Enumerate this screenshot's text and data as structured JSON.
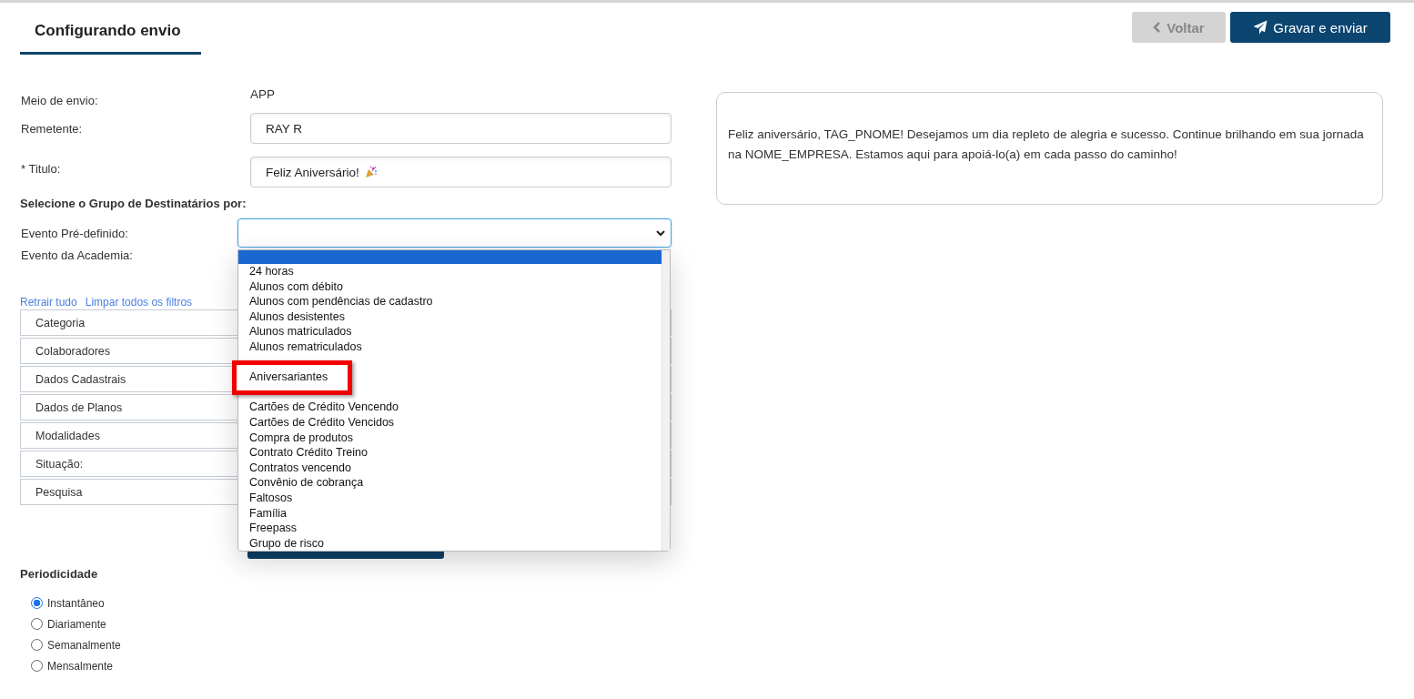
{
  "header": {
    "title": "Configurando envio"
  },
  "actions": [
    {
      "label": "Voltar",
      "kind": "back"
    },
    {
      "label": "Gravar e enviar",
      "kind": "send"
    }
  ],
  "form": {
    "sender_type": {
      "label": "Meio de envio:",
      "value": "APP"
    },
    "sender": {
      "label": "Remetente:",
      "value": "RAY R"
    },
    "title": {
      "label": "* Titulo:",
      "value": "Feliz Aniversário!"
    },
    "group_heading": "Selecione o Grupo de Destinatários por:",
    "predefined_event": {
      "label": "Evento Pré-definido:",
      "expanded": true,
      "options": [
        {
          "selected": true,
          "callout": false
        },
        {
          "label": "24 horas",
          "selected": false,
          "callout": false
        },
        {
          "label": "Alunos com débito",
          "selected": false,
          "callout": false
        },
        {
          "label": "Alunos com pendências de cadastro",
          "selected": false,
          "callout": false
        },
        {
          "label": "Alunos desistentes",
          "selected": false,
          "callout": false
        },
        {
          "label": "Alunos matriculados",
          "selected": false,
          "callout": false
        },
        {
          "label": "Alunos rematriculados",
          "selected": false,
          "callout": false
        },
        {
          "label": "Aniversariantes",
          "selected": false,
          "callout": true
        },
        {
          "label": "Cartões de Crédito Vencendo",
          "selected": false,
          "callout": false
        },
        {
          "label": "Cartões de Crédito Vencidos",
          "selected": false,
          "callout": false
        },
        {
          "label": "Compra de produtos",
          "selected": false,
          "callout": false
        },
        {
          "label": "Contrato Crédito Treino",
          "selected": false,
          "callout": false
        },
        {
          "label": "Contratos vencendo",
          "selected": false,
          "callout": false
        },
        {
          "label": "Convênio de cobrança",
          "selected": false,
          "callout": false
        },
        {
          "label": "Faltosos",
          "selected": false,
          "callout": false
        },
        {
          "label": "Família",
          "selected": false,
          "callout": false
        },
        {
          "label": "Freepass",
          "selected": false,
          "callout": false
        },
        {
          "label": "Grupo de risco",
          "selected": false,
          "callout": false
        }
      ]
    },
    "academy_event": {
      "label": "Evento da Academia:"
    }
  },
  "filter_links": [
    "Retrair tudo",
    "Limpar todos os filtros"
  ],
  "filter_sections": [
    {
      "label": "Categoria"
    },
    {
      "label": "Colaboradores"
    },
    {
      "label": "Dados Cadastrais"
    },
    {
      "label": "Dados de Planos"
    },
    {
      "label": "Modalidades"
    },
    {
      "label": "Situação:"
    },
    {
      "label": "Pesquisa"
    }
  ],
  "periodicity": {
    "title": "Periodicidade",
    "options": [
      {
        "label": "Instantâneo",
        "selected": true
      },
      {
        "label": "Diariamente",
        "selected": false
      },
      {
        "label": "Semanalmente",
        "selected": false
      },
      {
        "label": "Mensalmente",
        "selected": false
      }
    ]
  },
  "message_preview": {
    "text": "Feliz aniversário, TAG_PNOME! Desejamos um dia repleto de alegria e sucesso. Continue brilhando em sua jornada na NOME_EMPRESA. Estamos aqui para apoiá-lo(a) em cada passo do caminho!"
  }
}
